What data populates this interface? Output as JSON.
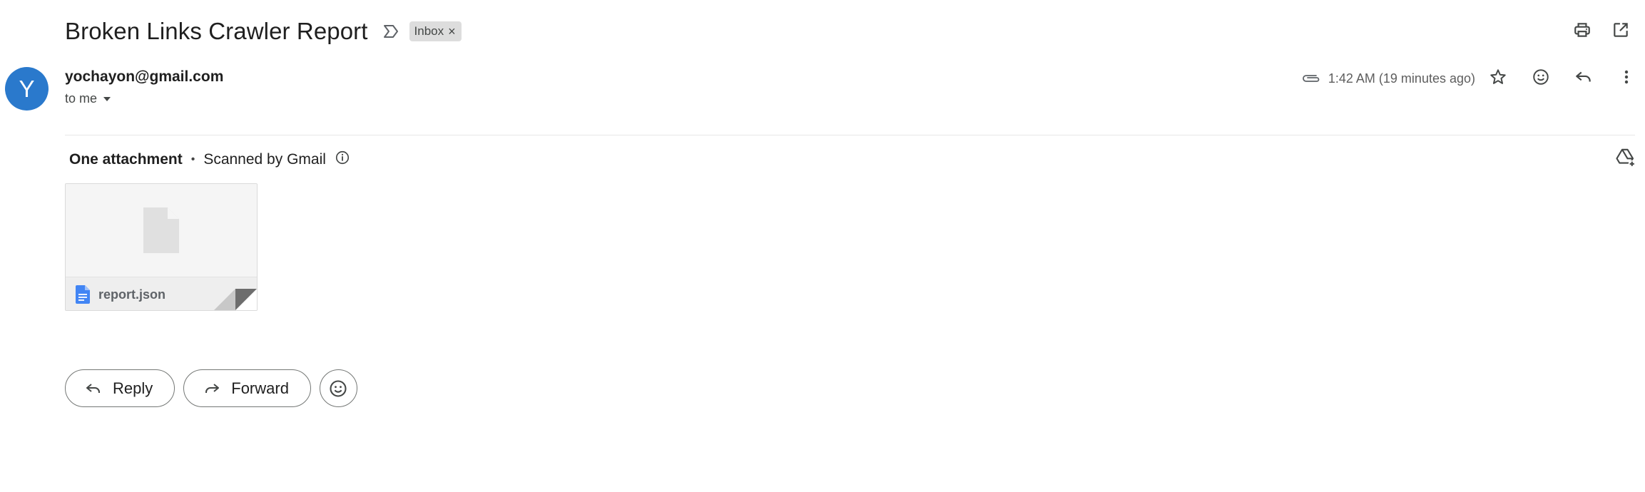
{
  "email": {
    "subject": "Broken Links Crawler Report",
    "label": "Inbox",
    "sender": "yochayon@gmail.com",
    "avatar_letter": "Y",
    "recipients": "to me",
    "timestamp": "1:42 AM (19 minutes ago)"
  },
  "attachments": {
    "heading": "One attachment",
    "separator": "•",
    "scan_note": "Scanned by Gmail",
    "files": [
      {
        "name": "report.json",
        "type_icon": "google-doc-icon"
      }
    ]
  },
  "actions": {
    "reply_label": "Reply",
    "forward_label": "Forward"
  },
  "colors": {
    "avatar": "#2a79cc",
    "doc_icon": "#4285f4",
    "label_chip": "#dddddd"
  }
}
